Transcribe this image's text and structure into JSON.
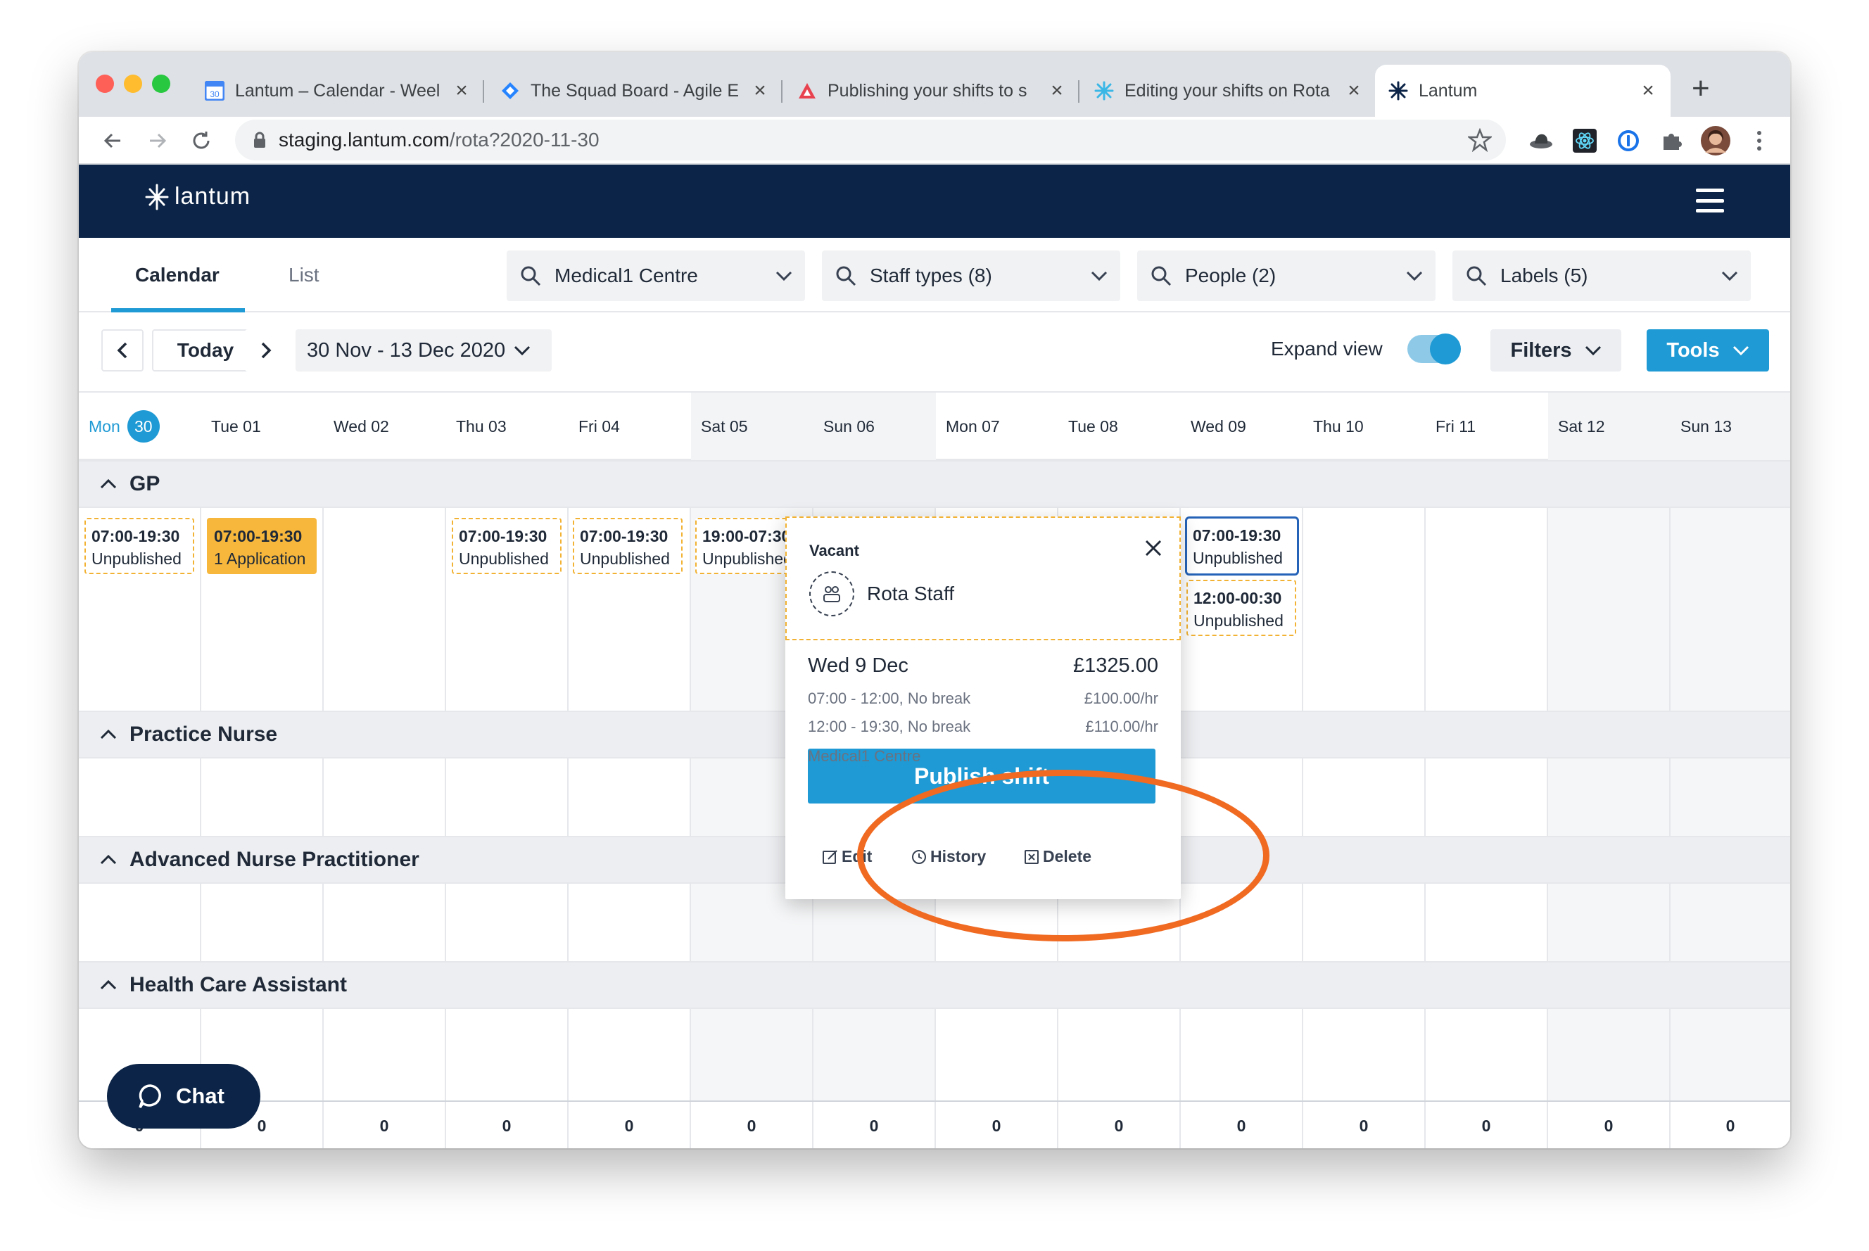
{
  "browser": {
    "tabs": [
      {
        "title": "Lantum – Calendar - Weel",
        "active": false
      },
      {
        "title": "The Squad Board - Agile E",
        "active": false
      },
      {
        "title": "Publishing your shifts to s",
        "active": false
      },
      {
        "title": "Editing your shifts on Rota",
        "active": false
      },
      {
        "title": "Lantum",
        "active": true
      }
    ],
    "url_host": "staging.lantum.com",
    "url_path": "/rota?2020-11-30",
    "new_tab_label": "+"
  },
  "app": {
    "logo_text": "lantum"
  },
  "view_tabs": [
    {
      "label": "Calendar",
      "active": true
    },
    {
      "label": "List",
      "active": false
    }
  ],
  "search_fields": [
    {
      "label": "Medical1 Centre"
    },
    {
      "label": "Staff types (8)"
    },
    {
      "label": "People (2)"
    },
    {
      "label": "Labels (5)"
    }
  ],
  "toolbar": {
    "today_label": "Today",
    "date_range": "30 Nov - 13 Dec 2020",
    "expand_view_label": "Expand view",
    "expand_view_on": true,
    "filters_label": "Filters",
    "tools_label": "Tools"
  },
  "days": [
    {
      "label": "Mon",
      "badge": "30",
      "today": true,
      "weekend": false
    },
    {
      "label": "Tue 01",
      "weekend": false
    },
    {
      "label": "Wed 02",
      "weekend": false
    },
    {
      "label": "Thu 03",
      "weekend": false
    },
    {
      "label": "Fri 04",
      "weekend": false
    },
    {
      "label": "Sat 05",
      "weekend": true
    },
    {
      "label": "Sun 06",
      "weekend": true
    },
    {
      "label": "Mon 07",
      "weekend": false
    },
    {
      "label": "Tue 08",
      "weekend": false
    },
    {
      "label": "Wed 09",
      "weekend": false
    },
    {
      "label": "Thu 10",
      "weekend": false
    },
    {
      "label": "Fri 11",
      "weekend": false
    },
    {
      "label": "Sat 12",
      "weekend": true
    },
    {
      "label": "Sun 13",
      "weekend": true
    }
  ],
  "sections": [
    {
      "label": "GP"
    },
    {
      "label": "Practice Nurse"
    },
    {
      "label": "Advanced Nurse Practitioner"
    },
    {
      "label": "Health Care Assistant"
    }
  ],
  "shifts": [
    {
      "time": "07:00-19:30",
      "status": "Unpublished"
    },
    {
      "time": "07:00-19:30",
      "status": "1 Application"
    },
    {
      "time": "07:00-19:30",
      "status": "Unpublished"
    },
    {
      "time": "07:00-19:30",
      "status": "Unpublished"
    },
    {
      "time": "19:00-07:30",
      "status": "Unpublished"
    },
    {
      "time": "07:00-19:30",
      "status": "Unpublished"
    },
    {
      "time": "12:00-00:30",
      "status": "Unpublished"
    }
  ],
  "footer_counts": [
    "0",
    "0",
    "0",
    "0",
    "0",
    "0",
    "0",
    "0",
    "0",
    "0",
    "0",
    "0",
    "0",
    "0"
  ],
  "popup": {
    "vacant_label": "Vacant",
    "staff_label": "Rota Staff",
    "date": "Wed 9 Dec",
    "total": "£1325.00",
    "line1": "07:00 - 12:00, No break",
    "rate1": "£100.00/hr",
    "line2": "12:00 - 19:30, No break",
    "rate2": "£110.00/hr",
    "location": "Medical1 Centre",
    "publish_label": "Publish shift",
    "edit_label": "Edit",
    "history_label": "History",
    "delete_label": "Delete"
  },
  "chat_label": "Chat",
  "colors": {
    "brand_navy": "#0b2447",
    "accent_blue": "#1f9ad4",
    "application_orange": "#f6b73c",
    "highlight_orange": "#f06a22"
  }
}
